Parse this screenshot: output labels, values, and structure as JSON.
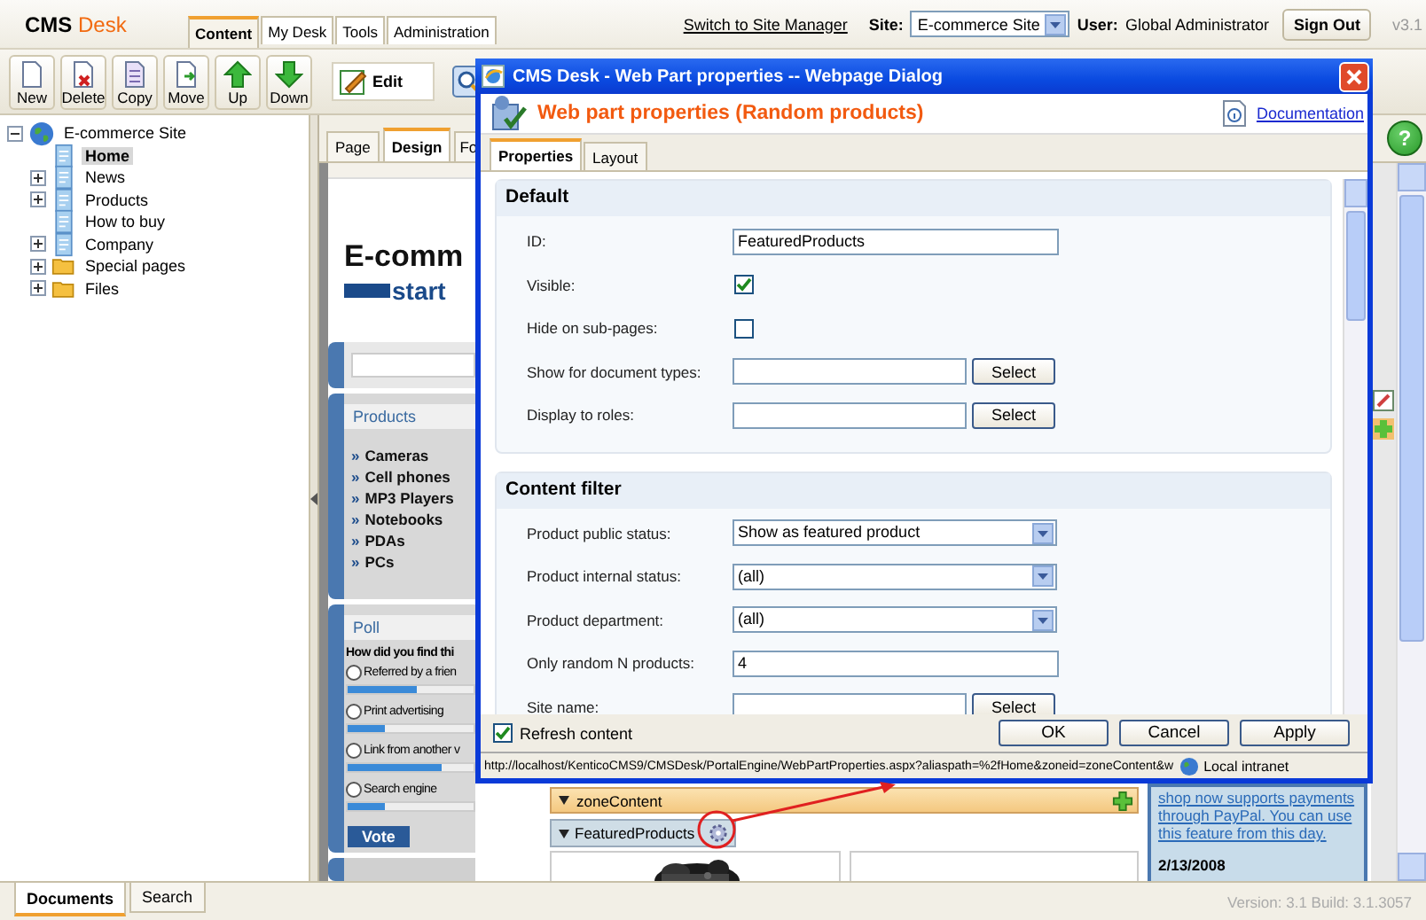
{
  "app": {
    "logo_main": "CMS",
    "logo_accent": "Desk",
    "version": "v3.1",
    "help_glyph": "?"
  },
  "main_tabs": [
    {
      "label": "Content",
      "selected": true
    },
    {
      "label": "My Desk",
      "selected": false
    },
    {
      "label": "Tools",
      "selected": false
    },
    {
      "label": "Administration",
      "selected": false
    }
  ],
  "header": {
    "switch_link": "Switch to Site Manager",
    "site_label": "Site:",
    "site_value": "E-commerce Site",
    "user_label": "User:",
    "user_name": "Global Administrator",
    "sign_out": "Sign Out"
  },
  "toolbar": {
    "buttons": [
      {
        "label": "New",
        "kind": "new"
      },
      {
        "label": "Delete",
        "kind": "delete"
      },
      {
        "label": "Copy",
        "kind": "copy"
      },
      {
        "label": "Move",
        "kind": "move"
      },
      {
        "label": "Up",
        "kind": "up"
      },
      {
        "label": "Down",
        "kind": "down"
      }
    ],
    "edit": "Edit"
  },
  "tree": {
    "root": {
      "label": "E-commerce Site",
      "expanded": true,
      "children": [
        {
          "label": "Home",
          "kind": "page",
          "expandable": false,
          "selected": true
        },
        {
          "label": "News",
          "kind": "page",
          "expandable": true,
          "expanded": false,
          "selected": false
        },
        {
          "label": "Products",
          "kind": "page",
          "expandable": true,
          "expanded": false,
          "selected": false
        },
        {
          "label": "How to buy",
          "kind": "page",
          "expandable": false,
          "selected": false
        },
        {
          "label": "Company",
          "kind": "page",
          "expandable": true,
          "expanded": false,
          "selected": false
        },
        {
          "label": "Special pages",
          "kind": "folder",
          "expandable": true,
          "expanded": false,
          "selected": false
        },
        {
          "label": "Files",
          "kind": "folder",
          "expandable": true,
          "expanded": false,
          "selected": false
        }
      ]
    }
  },
  "content_tabs": [
    {
      "label": "Page",
      "selected": false
    },
    {
      "label": "Design",
      "selected": true
    },
    {
      "label": "Fo",
      "selected": false
    }
  ],
  "preview": {
    "logo_top": "E-comm",
    "logo_bottom": "start",
    "menu_title": "Products",
    "menu_items": [
      {
        "bullet": "»",
        "label": "Cameras"
      },
      {
        "bullet": "»",
        "label": "Cell phones"
      },
      {
        "bullet": "»",
        "label": "MP3 Players"
      },
      {
        "bullet": "»",
        "label": "Notebooks"
      },
      {
        "bullet": "»",
        "label": "PDAs"
      },
      {
        "bullet": "»",
        "label": "PCs"
      }
    ],
    "poll_title": "Poll",
    "poll_question": "How did you find thi",
    "poll_options": [
      {
        "label": "Referred by a frien",
        "level": 0.55,
        "selected": false
      },
      {
        "label": "Print advertising",
        "level": 0.3,
        "selected": false
      },
      {
        "label": "Link from another v",
        "level": 0.75,
        "selected": false
      },
      {
        "label": "Search engine",
        "level": 0.3,
        "selected": false
      }
    ],
    "vote": "Vote",
    "zone_title": "zoneContent",
    "webpart_title": "FeaturedProducts",
    "news_text": "shop now supports payments through PayPal. You can use this feature from this day.",
    "news_date": "2/13/2008"
  },
  "dialog": {
    "title": "CMS Desk - Web Part properties -- Webpage Dialog",
    "heading": "Web part properties (Random products)",
    "doc_link": "Documentation",
    "tabs": [
      {
        "label": "Properties",
        "selected": true
      },
      {
        "label": "Layout",
        "selected": false
      }
    ],
    "sections": [
      {
        "title": "Default",
        "fields": [
          {
            "label": "ID:",
            "kind": "text",
            "value": "FeaturedProducts"
          },
          {
            "label": "Visible:",
            "kind": "checkbox",
            "checked": true
          },
          {
            "label": "Hide on sub-pages:",
            "kind": "checkbox",
            "checked": false
          },
          {
            "label": "Show for document types:",
            "kind": "picker",
            "button": "Select"
          },
          {
            "label": "Display to roles:",
            "kind": "picker",
            "button": "Select"
          }
        ]
      },
      {
        "title": "Content filter",
        "fields": [
          {
            "label": "Product public status:",
            "kind": "select",
            "value": "Show as featured product"
          },
          {
            "label": "Product internal status:",
            "kind": "select",
            "value": "(all)"
          },
          {
            "label": "Product department:",
            "kind": "select",
            "value": "(all)"
          },
          {
            "label": "Only random N products:",
            "kind": "text",
            "value": "4"
          },
          {
            "label": "Site name:",
            "kind": "picker",
            "button": "Select"
          }
        ]
      }
    ],
    "refresh": {
      "label": "Refresh content",
      "checked": true
    },
    "buttons": [
      "OK",
      "Cancel",
      "Apply"
    ],
    "url": "http://localhost/KenticoCMS9/CMSDesk/PortalEngine/WebPartProperties.aspx?aliaspath=%2fHome&zoneid=zoneContent&w",
    "zone": "Local intranet"
  },
  "bottom_tabs": [
    {
      "label": "Documents",
      "selected": true
    },
    {
      "label": "Search",
      "selected": false
    }
  ],
  "build": "Version: 3.1 Build: 3.1.3057"
}
